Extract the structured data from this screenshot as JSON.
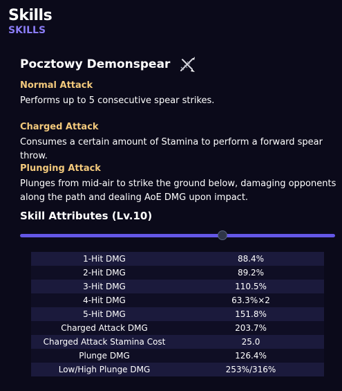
{
  "header": {
    "title": "Skills",
    "subtitle": "SKILLS"
  },
  "weapon": {
    "name": "Pocztowy Demonspear",
    "icon": "crossed-spears-icon"
  },
  "attacks": [
    {
      "title": "Normal Attack",
      "description": "Performs up to 5 consecutive spear strikes."
    },
    {
      "title": "Charged Attack",
      "description": "Consumes a certain amount of Stamina to perform a forward spear throw."
    },
    {
      "title": "Plunging Attack",
      "description": "Plunges from mid-air to strike the ground below, damaging opponents along the path and dealing AoE DMG upon impact."
    }
  ],
  "attributes": {
    "title": "Skill Attributes (Lv.10)",
    "slider": {
      "level": 10,
      "min": 1,
      "max": 15
    },
    "rows": [
      {
        "label": "1-Hit DMG",
        "value": "88.4%"
      },
      {
        "label": "2-Hit DMG",
        "value": "89.2%"
      },
      {
        "label": "3-Hit DMG",
        "value": "110.5%"
      },
      {
        "label": "4-Hit DMG",
        "value": "63.3%×2"
      },
      {
        "label": "5-Hit DMG",
        "value": "151.8%"
      },
      {
        "label": "Charged Attack DMG",
        "value": "203.7%"
      },
      {
        "label": "Charged Attack Stamina Cost",
        "value": "25.0"
      },
      {
        "label": "Plunge DMG",
        "value": "126.4%"
      },
      {
        "label": "Low/High Plunge DMG",
        "value": "253%/316%"
      }
    ]
  },
  "colors": {
    "accent": "#6457e6",
    "attack_title": "#f3c97c",
    "background": "#0b0a1a"
  }
}
